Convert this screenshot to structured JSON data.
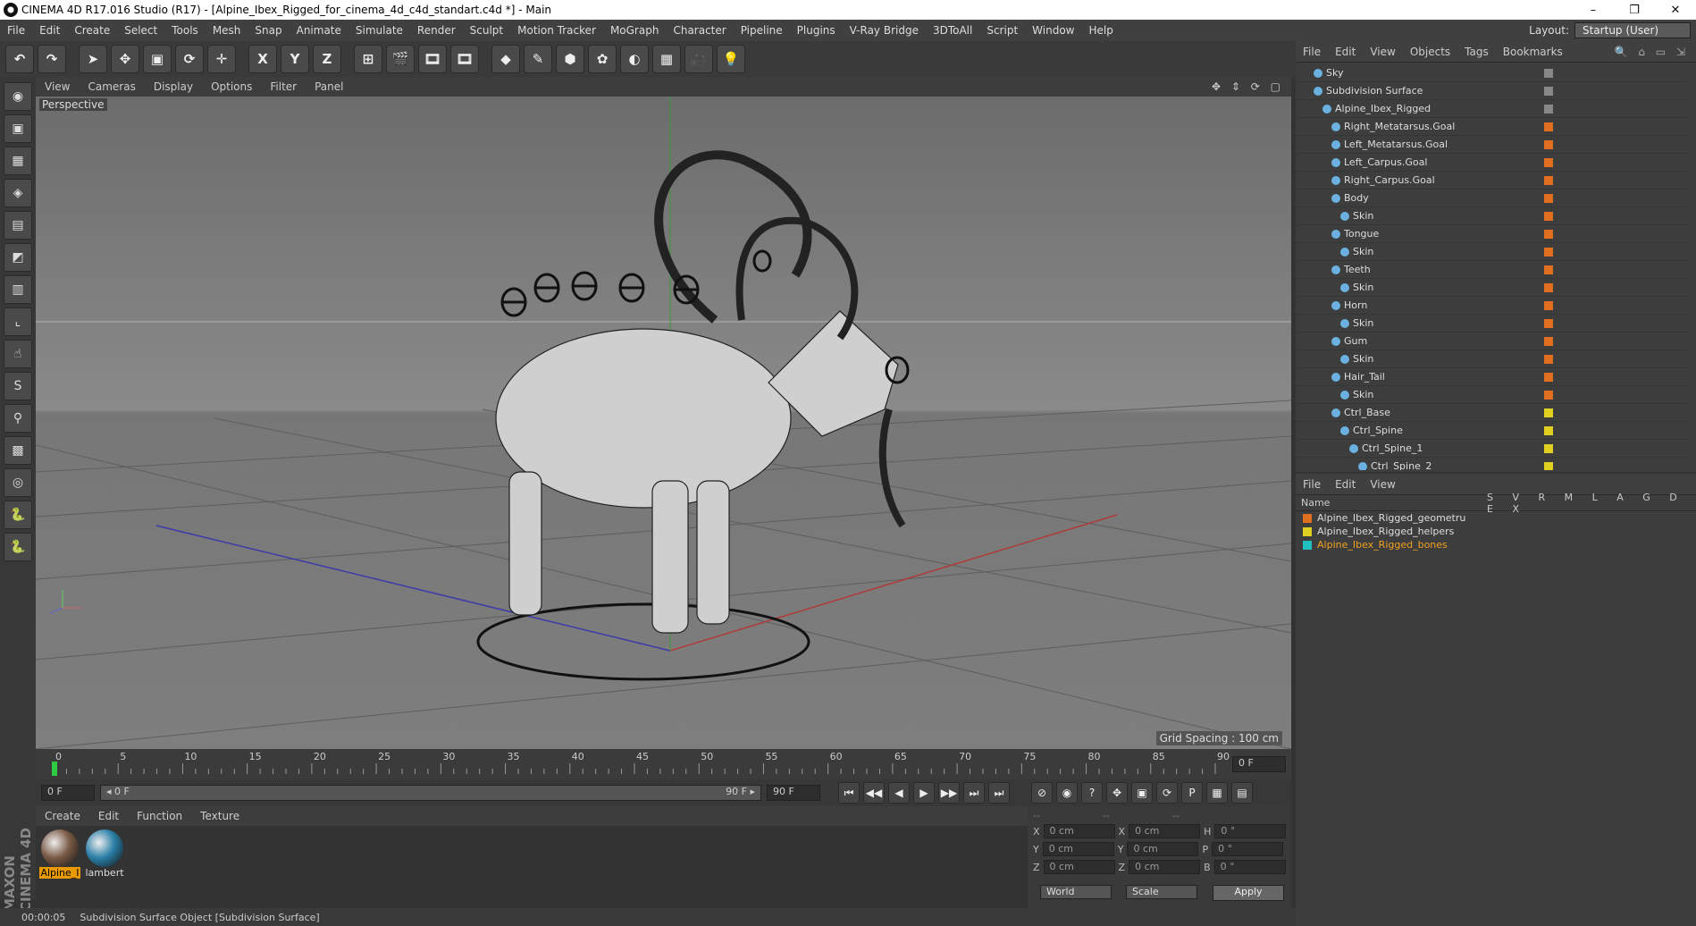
{
  "window": {
    "title": "CINEMA 4D R17.016 Studio (R17) - [Alpine_Ibex_Rigged_for_cinema_4d_c4d_standart.c4d *] - Main",
    "controls": [
      "–",
      "❐",
      "✕"
    ]
  },
  "menu": {
    "items": [
      "File",
      "Edit",
      "Create",
      "Select",
      "Tools",
      "Mesh",
      "Snap",
      "Animate",
      "Simulate",
      "Render",
      "Sculpt",
      "Motion Tracker",
      "MoGraph",
      "Character",
      "Pipeline",
      "Plugins",
      "V-Ray Bridge",
      "3DToAll",
      "Script",
      "Window",
      "Help"
    ],
    "layout_label": "Layout:",
    "layout_value": "Startup (User)"
  },
  "toolbar": {
    "buttons": [
      "↶",
      "↷",
      "➤",
      "✥",
      "▣",
      "⟳",
      "✛",
      "X",
      "Y",
      "Z",
      "⊞",
      "🎬",
      "🎞",
      "🎞",
      "◆",
      "✎",
      "⬢",
      "✿",
      "◐",
      "▦",
      "🎥",
      "💡"
    ]
  },
  "left_tools": [
    "◉",
    "▣",
    "▦",
    "◈",
    "▤",
    "◩",
    "▥",
    "⌞",
    "☝",
    "S",
    "⚲",
    "▩",
    "◎",
    "🐍",
    "🐍"
  ],
  "viewport": {
    "menu": [
      "View",
      "Cameras",
      "Display",
      "Options",
      "Filter",
      "Panel"
    ],
    "nav_icons": "✥ ⇕ ⟳ ▢",
    "label": "Perspective",
    "grid_info": "Grid Spacing : 100 cm"
  },
  "timeline": {
    "ticks": [
      "0",
      "5",
      "10",
      "15",
      "20",
      "25",
      "30",
      "35",
      "40",
      "45",
      "50",
      "55",
      "60",
      "65",
      "70",
      "75",
      "80",
      "85",
      "90"
    ],
    "current_frame": "0 F"
  },
  "transport": {
    "start": "0 F",
    "range_start": "◂ 0 F",
    "range_end": "90 F ▸",
    "end": "90 F",
    "buttons": [
      "⏮",
      "◀◀",
      "◀",
      "▶",
      "▶▶",
      "⏭",
      "⏭"
    ],
    "key_buttons": [
      "⊘",
      "◉",
      "?",
      "✥",
      "▣",
      "⟳",
      "P",
      "▦",
      "▤"
    ]
  },
  "materials": {
    "menu": [
      "Create",
      "Edit",
      "Function",
      "Texture"
    ],
    "items": [
      {
        "label": "Alpine_I",
        "color": "#7a5a46",
        "selected": true
      },
      {
        "label": "lambert",
        "color": "#2b7fa8",
        "selected": false
      }
    ]
  },
  "coords": {
    "headers": [
      "--",
      "--",
      "--"
    ],
    "rows": [
      {
        "a": "X",
        "av": "0 cm",
        "b": "X",
        "bv": "0 cm",
        "c": "H",
        "cv": "0 °"
      },
      {
        "a": "Y",
        "av": "0 cm",
        "b": "Y",
        "bv": "0 cm",
        "c": "P",
        "cv": "0 °"
      },
      {
        "a": "Z",
        "av": "0 cm",
        "b": "Z",
        "bv": "0 cm",
        "c": "B",
        "cv": "0 °"
      }
    ],
    "world": "World",
    "scale": "Scale",
    "apply": "Apply"
  },
  "status": {
    "time": "00:00:05",
    "text": "Subdivision Surface Object [Subdivision Surface]"
  },
  "object_manager": {
    "menu": [
      "File",
      "Edit",
      "View",
      "Objects",
      "Tags",
      "Bookmarks"
    ],
    "right_icons": "🔍 ⌂ ▭ ⇲",
    "objects": [
      {
        "name": "Sky",
        "indent": 0,
        "tag": "#888"
      },
      {
        "name": "Subdivision Surface",
        "indent": 0,
        "tag": "#888"
      },
      {
        "name": "Alpine_Ibex_Rigged",
        "indent": 1,
        "tag": "#888"
      },
      {
        "name": "Right_Metatarsus.Goal",
        "indent": 2,
        "tag": "#e07020"
      },
      {
        "name": "Left_Metatarsus.Goal",
        "indent": 2,
        "tag": "#e07020"
      },
      {
        "name": "Left_Carpus.Goal",
        "indent": 2,
        "tag": "#e07020"
      },
      {
        "name": "Right_Carpus.Goal",
        "indent": 2,
        "tag": "#e07020"
      },
      {
        "name": "Body",
        "indent": 2,
        "tag": "#e07020"
      },
      {
        "name": "Skin",
        "indent": 3,
        "tag": "#e07020"
      },
      {
        "name": "Tongue",
        "indent": 2,
        "tag": "#e07020"
      },
      {
        "name": "Skin",
        "indent": 3,
        "tag": "#e07020"
      },
      {
        "name": "Teeth",
        "indent": 2,
        "tag": "#e07020"
      },
      {
        "name": "Skin",
        "indent": 3,
        "tag": "#e07020"
      },
      {
        "name": "Horn",
        "indent": 2,
        "tag": "#e07020"
      },
      {
        "name": "Skin",
        "indent": 3,
        "tag": "#e07020"
      },
      {
        "name": "Gum",
        "indent": 2,
        "tag": "#e07020"
      },
      {
        "name": "Skin",
        "indent": 3,
        "tag": "#e07020"
      },
      {
        "name": "Hair_Tail",
        "indent": 2,
        "tag": "#e07020"
      },
      {
        "name": "Skin",
        "indent": 3,
        "tag": "#e07020"
      },
      {
        "name": "Ctrl_Base",
        "indent": 2,
        "tag": "#e0d020"
      },
      {
        "name": "Ctrl_Spine",
        "indent": 3,
        "tag": "#e0d020"
      },
      {
        "name": "Ctrl_Spine_1",
        "indent": 4,
        "tag": "#e0d020"
      },
      {
        "name": "Ctrl_Spine_2",
        "indent": 5,
        "tag": "#e0d020"
      }
    ]
  },
  "layer_manager": {
    "menu": [
      "File",
      "Edit",
      "View"
    ],
    "name_header": "Name",
    "columns": "S V R M L A G D E X",
    "layers": [
      {
        "name": "Alpine_Ibex_Rigged_geometru",
        "color": "#e07020",
        "active": false
      },
      {
        "name": "Alpine_Ibex_Rigged_helpers",
        "color": "#e0d020",
        "active": false
      },
      {
        "name": "Alpine_Ibex_Rigged_bones",
        "color": "#20c0c0",
        "active": true
      }
    ]
  }
}
